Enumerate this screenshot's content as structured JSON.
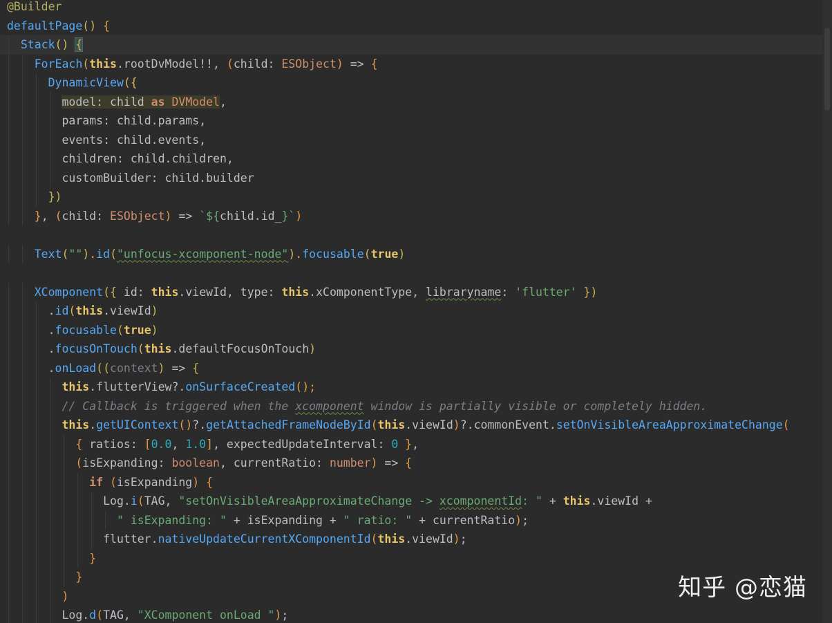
{
  "editor": {
    "lines": [
      [
        {
          "t": "@Builder",
          "c": "ann"
        }
      ],
      [
        {
          "t": "defaultPage",
          "c": "fn"
        },
        {
          "t": "() ",
          "c": "brace-y"
        },
        {
          "t": "{",
          "c": "brace-o"
        }
      ],
      [
        {
          "t": "Stack",
          "c": "fn"
        },
        {
          "t": "() ",
          "c": "brace-y"
        },
        {
          "t": "{",
          "c": "bracket-match brace-y"
        }
      ],
      [
        {
          "t": "ForEach",
          "c": "fn"
        },
        {
          "t": "(",
          "c": "brace-y"
        },
        {
          "t": "this",
          "c": "thiskw"
        },
        {
          "t": ".rootDvModel!!, ",
          "c": "punc"
        },
        {
          "t": "(",
          "c": "brace-o"
        },
        {
          "t": "child",
          "c": "param"
        },
        {
          "t": ": ",
          "c": "punc"
        },
        {
          "t": "ESObject",
          "c": "type"
        },
        {
          "t": ")",
          "c": "brace-o"
        },
        {
          "t": " => ",
          "c": "punc"
        },
        {
          "t": "{",
          "c": "brace-o"
        }
      ],
      [
        {
          "t": "DynamicView",
          "c": "fn"
        },
        {
          "t": "({",
          "c": "brace-y"
        }
      ],
      [
        {
          "t": "model",
          "c": "hl prop"
        },
        {
          "t": ": child ",
          "c": "hl punc"
        },
        {
          "t": "as",
          "c": "hl kwb"
        },
        {
          "t": " DVModel",
          "c": "hl type"
        },
        {
          "t": ",",
          "c": "punc"
        }
      ],
      [
        {
          "t": "params",
          "c": "prop"
        },
        {
          "t": ": child.params,",
          "c": "punc"
        }
      ],
      [
        {
          "t": "events",
          "c": "prop"
        },
        {
          "t": ": child.events,",
          "c": "punc"
        }
      ],
      [
        {
          "t": "children",
          "c": "prop"
        },
        {
          "t": ": child.children,",
          "c": "punc"
        }
      ],
      [
        {
          "t": "customBuilder",
          "c": "prop"
        },
        {
          "t": ": child.builder",
          "c": "punc"
        }
      ],
      [
        {
          "t": "})",
          "c": "brace-y"
        }
      ],
      [
        {
          "t": "}",
          "c": "brace-o"
        },
        {
          "t": ", ",
          "c": "punc"
        },
        {
          "t": "(",
          "c": "brace-o"
        },
        {
          "t": "child",
          "c": "param"
        },
        {
          "t": ": ",
          "c": "punc"
        },
        {
          "t": "ESObject",
          "c": "type"
        },
        {
          "t": ")",
          "c": "brace-o"
        },
        {
          "t": " => ",
          "c": "punc"
        },
        {
          "t": "`${",
          "c": "str"
        },
        {
          "t": "child.id_",
          "c": "punc"
        },
        {
          "t": "}`",
          "c": "str"
        },
        {
          "t": ")",
          "c": "brace-o"
        }
      ],
      [],
      [
        {
          "t": "Text",
          "c": "fn"
        },
        {
          "t": "(",
          "c": "brace-y"
        },
        {
          "t": "\"\"",
          "c": "str"
        },
        {
          "t": ").",
          "c": "brace-y"
        },
        {
          "t": "id",
          "c": "fn"
        },
        {
          "t": "(",
          "c": "brace-y"
        },
        {
          "t": "\"unfocus-xcomponent-node\"",
          "c": "str underline"
        },
        {
          "t": ").",
          "c": "brace-y"
        },
        {
          "t": "focusable",
          "c": "fn"
        },
        {
          "t": "(",
          "c": "brace-y"
        },
        {
          "t": "true",
          "c": "thiskw"
        },
        {
          "t": ")",
          "c": "brace-y"
        }
      ],
      [],
      [
        {
          "t": "XComponent",
          "c": "fn"
        },
        {
          "t": "({",
          "c": "brace-y"
        },
        {
          "t": " id: ",
          "c": "punc"
        },
        {
          "t": "this",
          "c": "thiskw"
        },
        {
          "t": ".viewId, type: ",
          "c": "punc"
        },
        {
          "t": "this",
          "c": "thiskw"
        },
        {
          "t": ".xComponentType, ",
          "c": "punc"
        },
        {
          "t": "libraryname",
          "c": "punc underline"
        },
        {
          "t": ": ",
          "c": "punc"
        },
        {
          "t": "'flutter'",
          "c": "str"
        },
        {
          "t": " })",
          "c": "brace-y"
        }
      ],
      [
        {
          "t": ".",
          "c": "punc"
        },
        {
          "t": "id",
          "c": "fn"
        },
        {
          "t": "(",
          "c": "brace-y"
        },
        {
          "t": "this",
          "c": "thiskw"
        },
        {
          "t": ".viewId",
          "c": "punc"
        },
        {
          "t": ")",
          "c": "brace-y"
        }
      ],
      [
        {
          "t": ".",
          "c": "punc"
        },
        {
          "t": "focusable",
          "c": "fn"
        },
        {
          "t": "(",
          "c": "brace-y"
        },
        {
          "t": "true",
          "c": "thiskw"
        },
        {
          "t": ")",
          "c": "brace-y"
        }
      ],
      [
        {
          "t": ".",
          "c": "punc"
        },
        {
          "t": "focusOnTouch",
          "c": "fn"
        },
        {
          "t": "(",
          "c": "brace-y"
        },
        {
          "t": "this",
          "c": "thiskw"
        },
        {
          "t": ".defaultFocusOnTouch",
          "c": "punc"
        },
        {
          "t": ")",
          "c": "brace-y"
        }
      ],
      [
        {
          "t": ".",
          "c": "punc"
        },
        {
          "t": "onLoad",
          "c": "fn"
        },
        {
          "t": "((",
          "c": "brace-y"
        },
        {
          "t": "context",
          "c": "gray"
        },
        {
          "t": ")",
          "c": "brace-y"
        },
        {
          "t": " => ",
          "c": "punc"
        },
        {
          "t": "{",
          "c": "brace-y"
        }
      ],
      [
        {
          "t": "this",
          "c": "thiskw"
        },
        {
          "t": ".flutterView?.",
          "c": "punc"
        },
        {
          "t": "onSurfaceCreated",
          "c": "fn"
        },
        {
          "t": "();",
          "c": "brace-o"
        }
      ],
      [
        {
          "t": "// Callback is triggered when the ",
          "c": "cmt"
        },
        {
          "t": "xcomponent",
          "c": "cmt underline"
        },
        {
          "t": " window is partially visible or completely hidden.",
          "c": "cmt"
        }
      ],
      [
        {
          "t": "this",
          "c": "thiskw"
        },
        {
          "t": ".",
          "c": "punc"
        },
        {
          "t": "getUIContext",
          "c": "fn"
        },
        {
          "t": "()",
          "c": "brace-o"
        },
        {
          "t": "?.",
          "c": "punc"
        },
        {
          "t": "getAttachedFrameNodeById",
          "c": "fn"
        },
        {
          "t": "(",
          "c": "brace-o"
        },
        {
          "t": "this",
          "c": "thiskw"
        },
        {
          "t": ".viewId",
          "c": "punc"
        },
        {
          "t": ")",
          "c": "brace-o"
        },
        {
          "t": "?.commonEvent.",
          "c": "punc"
        },
        {
          "t": "setOnVisibleAreaApproximateChange",
          "c": "fn"
        },
        {
          "t": "(",
          "c": "brace-o"
        }
      ],
      [
        {
          "t": "{",
          "c": "brace-o"
        },
        {
          "t": " ratios: ",
          "c": "punc"
        },
        {
          "t": "[",
          "c": "brace-o"
        },
        {
          "t": "0.0",
          "c": "num"
        },
        {
          "t": ", ",
          "c": "punc"
        },
        {
          "t": "1.0",
          "c": "num"
        },
        {
          "t": "]",
          "c": "brace-o"
        },
        {
          "t": ", expectedUpdateInterval: ",
          "c": "punc"
        },
        {
          "t": "0",
          "c": "num"
        },
        {
          "t": " }",
          "c": "brace-o"
        },
        {
          "t": ",",
          "c": "punc"
        }
      ],
      [
        {
          "t": "(",
          "c": "brace-o"
        },
        {
          "t": "isExpanding",
          "c": "param"
        },
        {
          "t": ": ",
          "c": "punc"
        },
        {
          "t": "boolean",
          "c": "type"
        },
        {
          "t": ", currentRatio: ",
          "c": "punc"
        },
        {
          "t": "number",
          "c": "type"
        },
        {
          "t": ")",
          "c": "brace-o"
        },
        {
          "t": " => ",
          "c": "punc"
        },
        {
          "t": "{",
          "c": "brace-o"
        }
      ],
      [
        {
          "t": "if",
          "c": "kwb"
        },
        {
          "t": " (",
          "c": "brace-o"
        },
        {
          "t": "isExpanding",
          "c": "punc"
        },
        {
          "t": ") ",
          "c": "brace-o"
        },
        {
          "t": "{",
          "c": "brace-o"
        }
      ],
      [
        {
          "t": "Log",
          "c": "cls"
        },
        {
          "t": ".",
          "c": "punc"
        },
        {
          "t": "i",
          "c": "fn"
        },
        {
          "t": "(",
          "c": "brace-o"
        },
        {
          "t": "TAG, ",
          "c": "punc"
        },
        {
          "t": "\"setOnVisibleAreaApproximateChange -> ",
          "c": "str"
        },
        {
          "t": "xcomponentId",
          "c": "str underline"
        },
        {
          "t": ": \"",
          "c": "str"
        },
        {
          "t": " + ",
          "c": "punc"
        },
        {
          "t": "this",
          "c": "thiskw"
        },
        {
          "t": ".viewId +",
          "c": "punc"
        }
      ],
      [
        {
          "t": "\" isExpanding: \"",
          "c": "str"
        },
        {
          "t": " + isExpanding + ",
          "c": "punc"
        },
        {
          "t": "\" ratio: \"",
          "c": "str"
        },
        {
          "t": " + currentRatio",
          "c": "punc"
        },
        {
          "t": ")",
          "c": "brace-o"
        },
        {
          "t": ";",
          "c": "punc"
        }
      ],
      [
        {
          "t": "flutter.",
          "c": "punc"
        },
        {
          "t": "nativeUpdateCurrentXComponentId",
          "c": "fn"
        },
        {
          "t": "(",
          "c": "brace-o"
        },
        {
          "t": "this",
          "c": "thiskw"
        },
        {
          "t": ".viewId",
          "c": "punc"
        },
        {
          "t": ")",
          "c": "brace-o"
        },
        {
          "t": ";",
          "c": "punc"
        }
      ],
      [
        {
          "t": "}",
          "c": "brace-o"
        }
      ],
      [
        {
          "t": "}",
          "c": "brace-o"
        }
      ],
      [
        {
          "t": ")",
          "c": "brace-o"
        }
      ],
      [
        {
          "t": "Log",
          "c": "cls"
        },
        {
          "t": ".",
          "c": "punc"
        },
        {
          "t": "d",
          "c": "fn"
        },
        {
          "t": "(",
          "c": "brace-o"
        },
        {
          "t": "TAG, ",
          "c": "punc"
        },
        {
          "t": "\"XComponent onLoad \"",
          "c": "str"
        },
        {
          "t": ")",
          "c": "brace-o"
        },
        {
          "t": ";",
          "c": "punc"
        }
      ]
    ]
  },
  "watermark": {
    "text": "知乎 @恋猫"
  }
}
